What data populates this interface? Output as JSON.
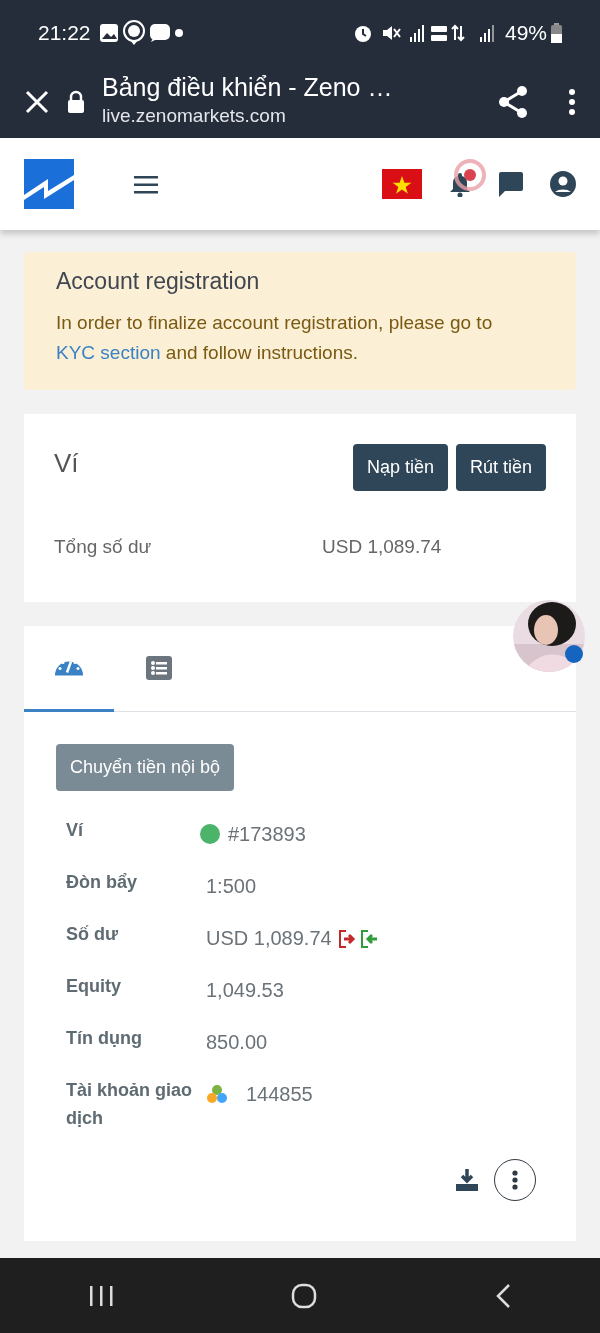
{
  "status_bar": {
    "time": "21:22",
    "battery": "49%"
  },
  "browser": {
    "page_title": "Bảng điều khiển - Zeno …",
    "url": "live.zenomarkets.com"
  },
  "site_header": {
    "notification_dot": true
  },
  "alert": {
    "title": "Account registration",
    "text_before": "In order to finalize account registration, please go to ",
    "link": "KYC section",
    "text_after": " and follow instructions."
  },
  "wallet": {
    "title": "Ví",
    "buttons": [
      "Nạp tiền",
      "Rút tiền"
    ],
    "total_label": "Tổng số dư",
    "total_value": "USD 1,089.74"
  },
  "account": {
    "tabs": [
      {
        "kind": "dashboard",
        "selected": true
      },
      {
        "kind": "list",
        "selected": false
      }
    ],
    "transfer_button": "Chuyển tiền nội bộ",
    "details": [
      {
        "kind": "status",
        "label": "Ví",
        "value": "#173893",
        "color": "#4cb46a"
      },
      {
        "kind": "plain",
        "label": "Đòn bẩy",
        "value": "1:500"
      },
      {
        "kind": "balance",
        "label": "Số dư",
        "value": "USD 1,089.74"
      },
      {
        "kind": "plain",
        "label": "Equity",
        "value": "1,049.53"
      },
      {
        "kind": "plain",
        "label": "Tín dụng",
        "value": "850.00"
      },
      {
        "kind": "platform",
        "label": "Tài khoản giao dịch",
        "value": "144855"
      }
    ]
  }
}
